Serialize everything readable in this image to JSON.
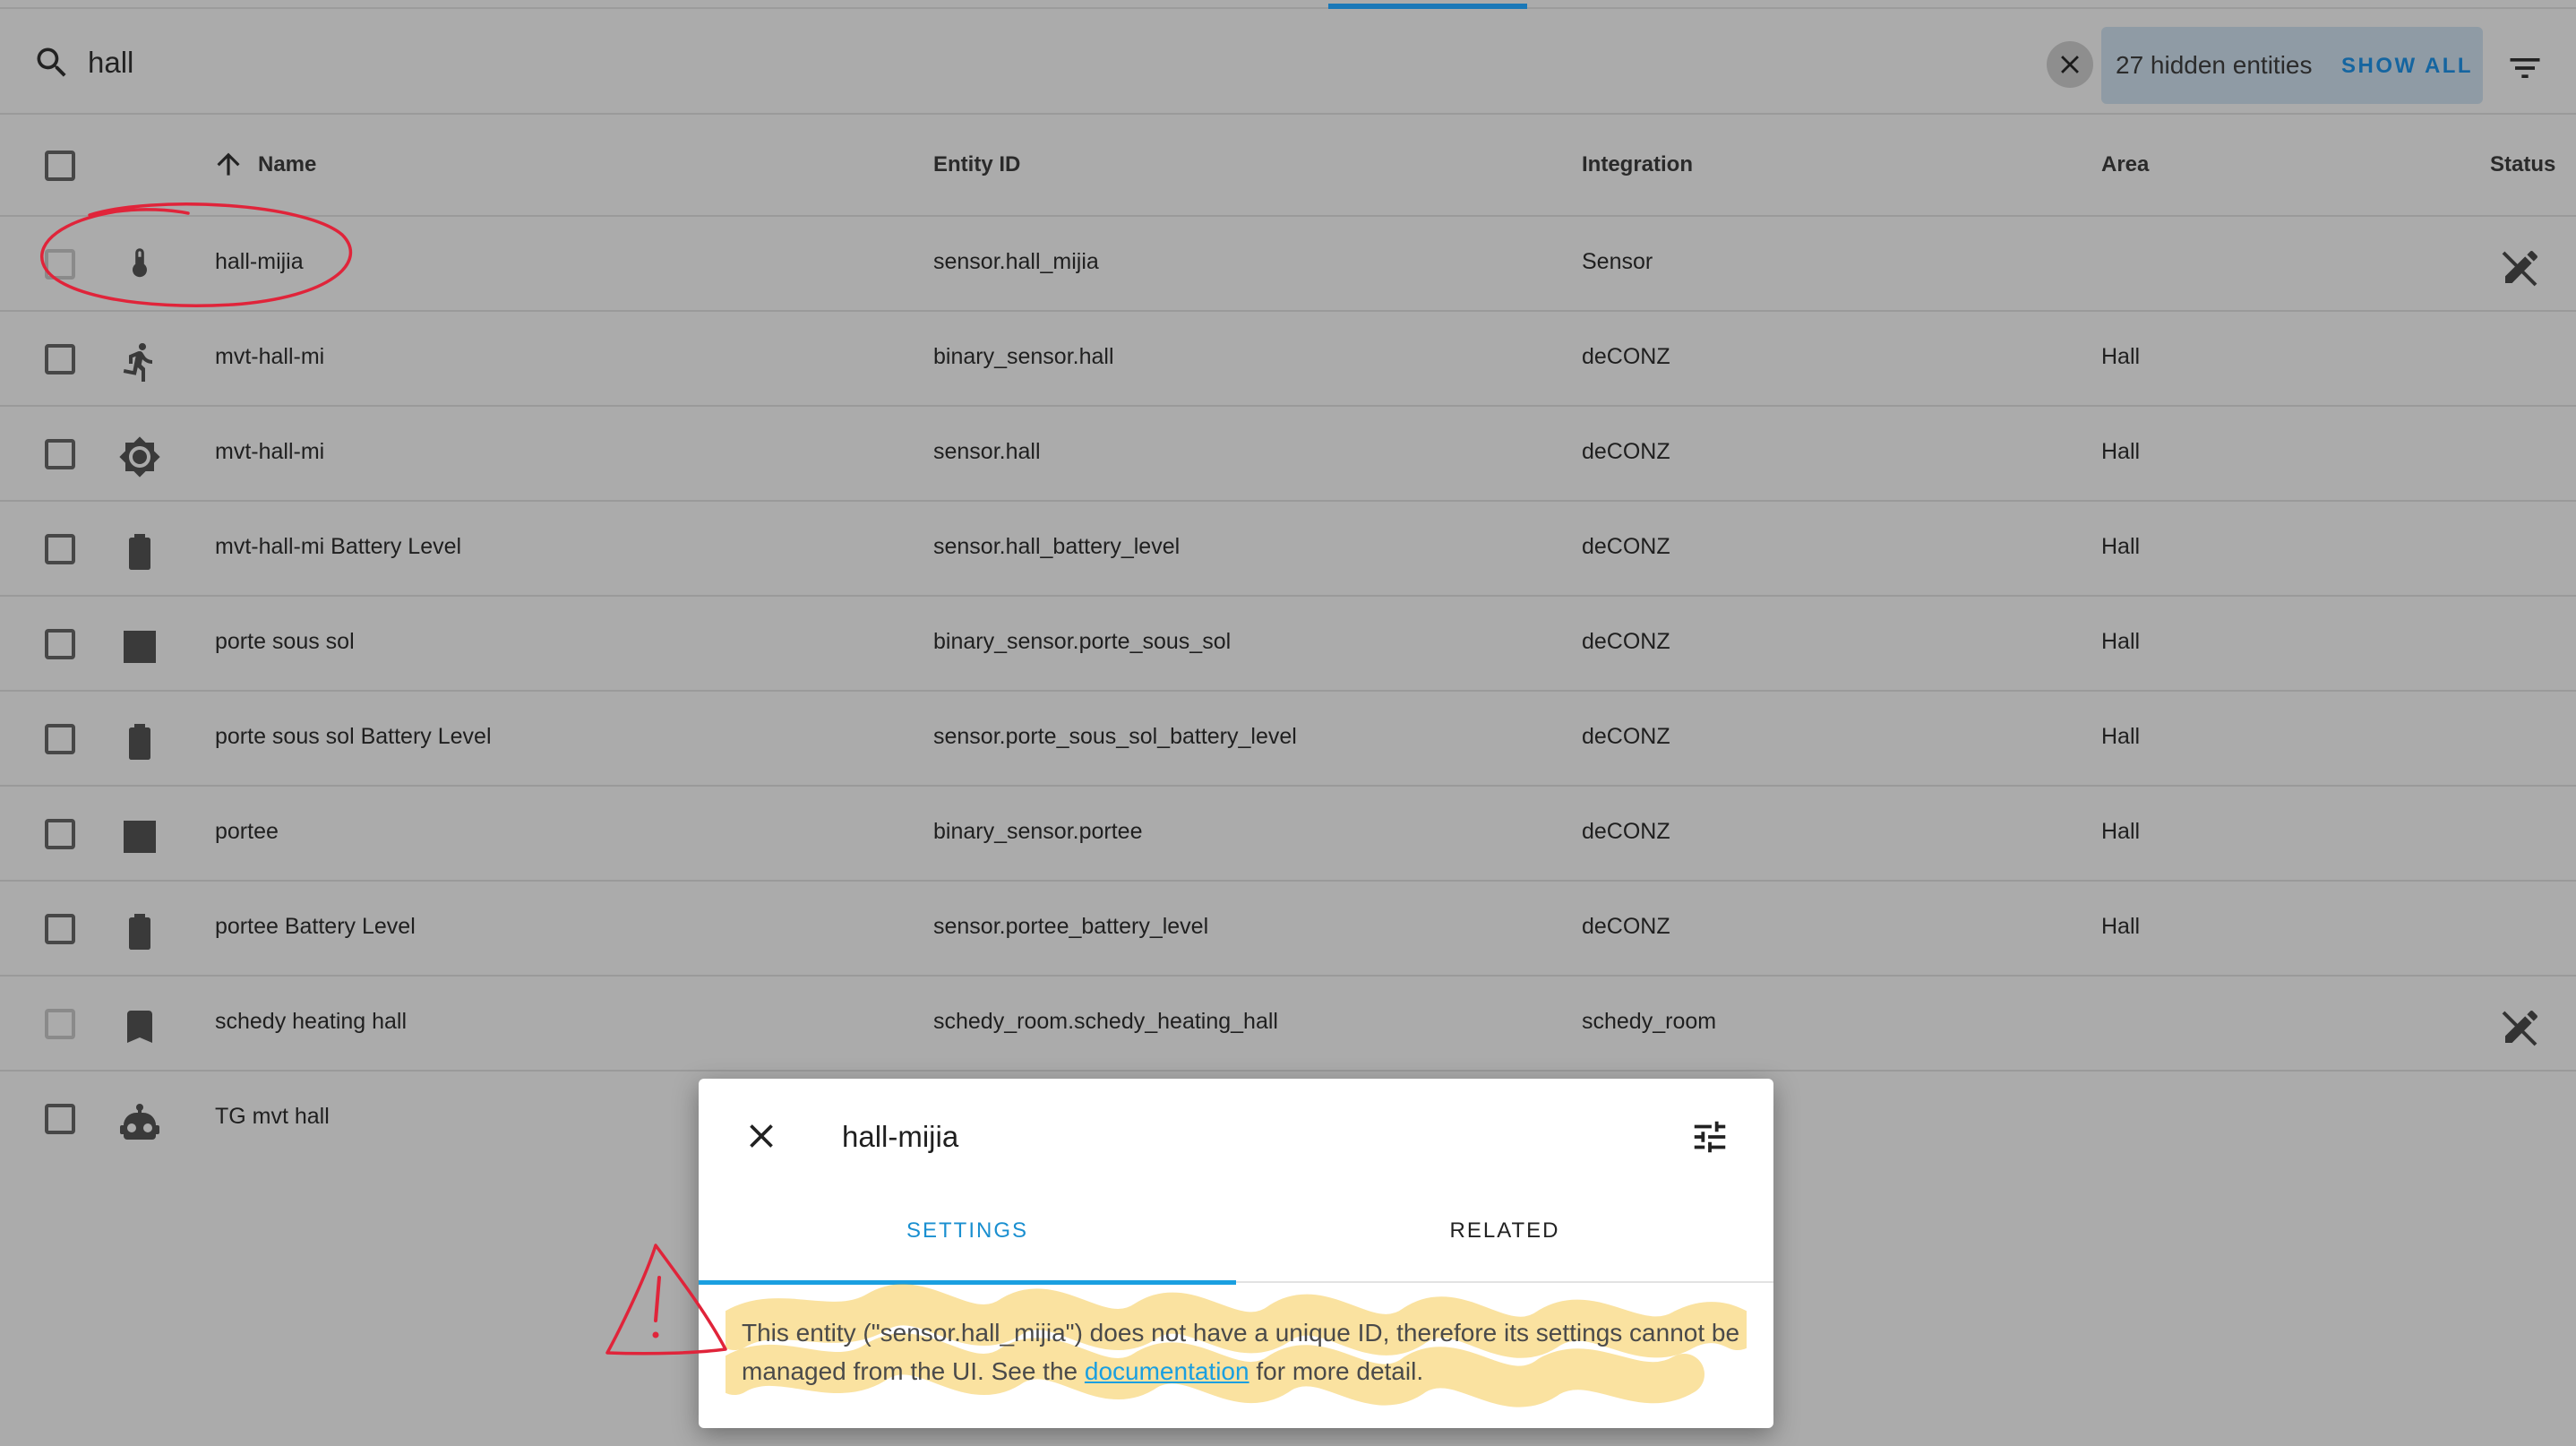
{
  "search": {
    "value": "hall",
    "placeholder": "Search"
  },
  "hidden": {
    "label": "27 hidden entities",
    "action": "SHOW ALL"
  },
  "columns": {
    "name": "Name",
    "entity_id": "Entity ID",
    "integration": "Integration",
    "area": "Area",
    "status": "Status"
  },
  "rows": [
    {
      "icon": "thermometer-icon",
      "name": "hall-mijia",
      "entity_id": "sensor.hall_mijia",
      "integration": "Sensor",
      "area": "",
      "status": "readonly-icon",
      "checkbox_disabled": true
    },
    {
      "icon": "motion-sensor-icon",
      "name": "mvt-hall-mi",
      "entity_id": "binary_sensor.hall",
      "integration": "deCONZ",
      "area": "Hall"
    },
    {
      "icon": "brightness-icon",
      "name": "mvt-hall-mi",
      "entity_id": "sensor.hall",
      "integration": "deCONZ",
      "area": "Hall"
    },
    {
      "icon": "battery-icon",
      "name": "mvt-hall-mi Battery Level",
      "entity_id": "sensor.hall_battery_level",
      "integration": "deCONZ",
      "area": "Hall"
    },
    {
      "icon": "door-closed-icon",
      "name": "porte sous sol",
      "entity_id": "binary_sensor.porte_sous_sol",
      "integration": "deCONZ",
      "area": "Hall"
    },
    {
      "icon": "battery-icon",
      "name": "porte sous sol Battery Level",
      "entity_id": "sensor.porte_sous_sol_battery_level",
      "integration": "deCONZ",
      "area": "Hall"
    },
    {
      "icon": "door-closed-icon",
      "name": "portee",
      "entity_id": "binary_sensor.portee",
      "integration": "deCONZ",
      "area": "Hall"
    },
    {
      "icon": "battery-icon",
      "name": "portee Battery Level",
      "entity_id": "sensor.portee_battery_level",
      "integration": "deCONZ",
      "area": "Hall"
    },
    {
      "icon": "bookmark-icon",
      "name": "schedy heating hall",
      "entity_id": "schedy_room.schedy_heating_hall",
      "integration": "schedy_room",
      "area": "",
      "status": "readonly-icon",
      "checkbox_disabled": true
    },
    {
      "icon": "robot-icon",
      "name": "TG mvt hall",
      "entity_id": "",
      "integration": "",
      "area": ""
    }
  ],
  "dialog": {
    "title": "hall-mijia",
    "tabs": [
      "SETTINGS",
      "RELATED"
    ],
    "message_before": "This entity (\"sensor.hall_mijia\") does not have a unique ID, therefore its settings cannot be managed from the UI. See the ",
    "link": "documentation",
    "message_after": " for more detail."
  },
  "colors": {
    "accent": "#1a9fe0",
    "annotation": "#e0243a",
    "highlight": "#f5c542"
  }
}
